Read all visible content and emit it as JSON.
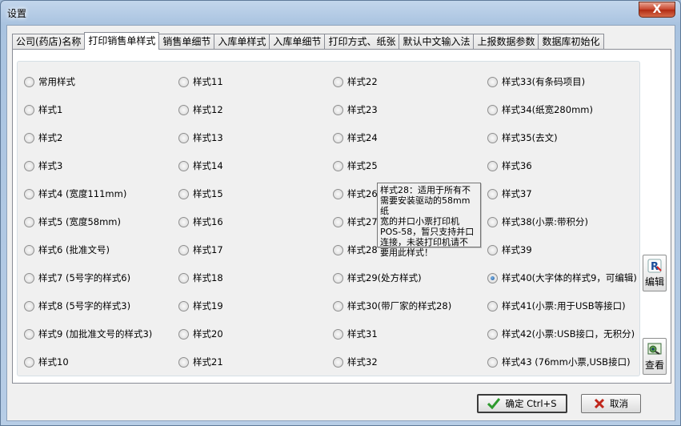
{
  "window": {
    "title": "设置",
    "close_label": "X"
  },
  "tabs": [
    {
      "label": "公司(药店)名称",
      "active": false
    },
    {
      "label": "打印销售单样式",
      "active": true
    },
    {
      "label": "销售单细节",
      "active": false
    },
    {
      "label": "入库单样式",
      "active": false
    },
    {
      "label": "入库单细节",
      "active": false
    },
    {
      "label": "打印方式、纸张",
      "active": false
    },
    {
      "label": "默认中文输入法",
      "active": false
    },
    {
      "label": "上报数据参数",
      "active": false
    },
    {
      "label": "数据库初始化",
      "active": false
    }
  ],
  "styles": {
    "col1": [
      "常用样式",
      "样式1",
      "样式2",
      "样式3",
      "样式4 (宽度111mm)",
      "样式5 (宽度58mm)",
      "样式6 (批准文号)",
      "样式7 (5号字的样式6)",
      "样式8 (5号字的样式3)",
      "样式9 (加批准文号的样式3)",
      "样式10"
    ],
    "col2": [
      "样式11",
      "样式12",
      "样式13",
      "样式14",
      "样式15",
      "样式16",
      "样式17",
      "样式18",
      "样式19",
      "样式20",
      "样式21"
    ],
    "col3": [
      "样式22",
      "样式23",
      "样式24",
      "样式25",
      "样式26",
      "样式27",
      "样式28",
      "样式29(处方样式)",
      "样式30(带厂家的样式28)",
      "样式31",
      "样式32"
    ],
    "col4": [
      "样式33(有条码项目)",
      "样式34(纸宽280mm)",
      "样式35(去文)",
      "样式36",
      "样式37",
      "样式38(小票:带积分)",
      "样式39",
      "样式40(大字体的样式9，可编辑)",
      "样式41(小票:用于USB等接口)",
      "样式42(小票:USB接口，无积分)",
      "样式43 (76mm小票,USB接口)"
    ],
    "selected": "样式40(大字体的样式9，可编辑)"
  },
  "tooltip": {
    "lines": [
      "样式28：适用于所有不",
      "需要安装驱动的58mm纸",
      "宽的并口小票打印机",
      "POS-58，暂只支持并口",
      "连接，未装打印机请不",
      "要用此样式！"
    ]
  },
  "side_buttons": {
    "edit_label": "编辑",
    "view_label": "查看"
  },
  "buttons": {
    "ok_label": "确定 Ctrl+S",
    "cancel_label": "取消"
  },
  "colors": {
    "accent": "#1b4f8a",
    "ok_check": "#2e9a2e",
    "cancel_x": "#c0261b"
  }
}
